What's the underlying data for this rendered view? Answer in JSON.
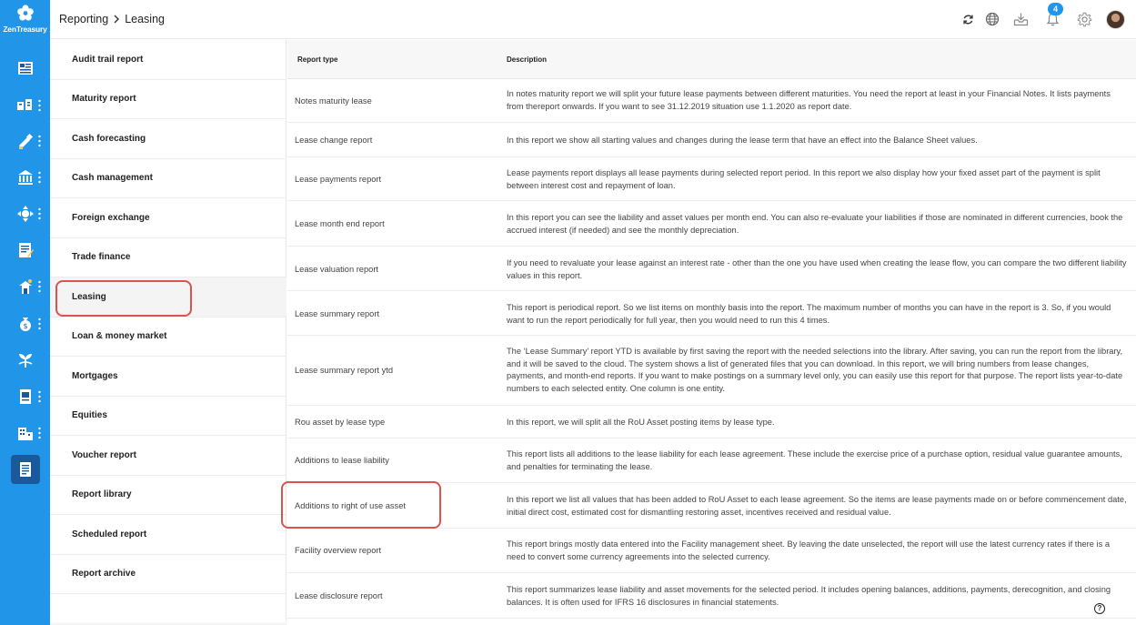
{
  "app": {
    "logo_text": "ZenTreasury"
  },
  "header": {
    "breadcrumb": [
      "Reporting",
      "Leasing"
    ],
    "notifications_count": "4"
  },
  "rail": {
    "items": [
      "dashboard",
      "accounts",
      "forecast",
      "bank",
      "fx",
      "documents",
      "trade",
      "money-bag",
      "plant",
      "ledger",
      "building",
      "report"
    ]
  },
  "subnav": {
    "items": [
      "Audit trail report",
      "Maturity report",
      "Cash forecasting",
      "Cash management",
      "Foreign exchange",
      "Trade finance",
      "Leasing",
      "Loan & money market",
      "Mortgages",
      "Equities",
      "Voucher report",
      "Report library",
      "Scheduled report",
      "Report archive"
    ],
    "selected": "Leasing"
  },
  "table": {
    "headers": {
      "type": "Report type",
      "description": "Description"
    },
    "rows": [
      {
        "type": "Notes maturity lease",
        "description": "In notes maturity report we will split your future lease payments between different maturities. You need the report at least in your Financial Notes. It lists payments from thereport onwards. If you want to see 31.12.2019 situation use 1.1.2020 as report date."
      },
      {
        "type": "Lease change report",
        "description": "In this report we show all starting values and changes during the lease term that have an effect into the Balance Sheet values."
      },
      {
        "type": "Lease payments report",
        "description": "Lease payments report displays all lease payments during selected report period. In this report we also display how your fixed asset part of the payment is split between interest cost and repayment of loan."
      },
      {
        "type": "Lease month end report",
        "description": "In this report you can see the liability and asset values per month end. You can also re-evaluate your liabilities if those are nominated in different currencies, book the accrued interest (if needed) and see the monthly depreciation."
      },
      {
        "type": "Lease valuation report",
        "description": "If you need to revaluate your lease against an interest rate - other than the one you have used when creating the lease flow, you can compare the two different liability values in this report."
      },
      {
        "type": "Lease summary report",
        "description": "This report is periodical report. So we list items on monthly basis into the report. The maximum number of months you can have in the report is 3. So, if you would want to run the report periodically for full year, then you would need to run this 4 times."
      },
      {
        "type": "Lease summary report ytd",
        "description": "The ‘Lease Summary’ report YTD is available by first saving the report with the needed selections into the library. After saving, you can run the report from the library, and it will be saved to the cloud. The system shows a list of generated files that you can download. In this report, we will bring numbers from lease changes, payments, and month-end reports. If you want to make postings on a summary level only, you can easily use this report for that purpose. The report lists year-to-date numbers to each selected entity. One column is one entity."
      },
      {
        "type": "Rou asset by lease type",
        "description": "In this report, we will split all the RoU Asset posting items by lease type."
      },
      {
        "type": "Additions to lease liability",
        "description": "This report lists all additions to the lease liability for each lease agreement. These include the exercise price of a purchase option, residual value guarantee amounts, and penalties for terminating the lease."
      },
      {
        "type": "Additions to right of use asset",
        "description": "In this report we list all values that has been added to RoU Asset to each lease agreement. So the items are lease payments made on or before commencement date, initial direct cost, estimated cost for dismantling restoring asset, incentives received and residual value."
      },
      {
        "type": "Facility overview report",
        "description": "This report brings mostly data entered into the Facility management sheet. By leaving the date unselected, the report will use the latest currency rates if there is a need to convert some currency agreements into the selected currency."
      },
      {
        "type": "Lease disclosure report",
        "description": "This report summarizes lease liability and asset movements for the selected period. It includes opening balances, additions, payments, derecognition, and closing balances. It is often used for IFRS 16 disclosures in financial statements."
      }
    ]
  },
  "help": {
    "label": "?"
  }
}
